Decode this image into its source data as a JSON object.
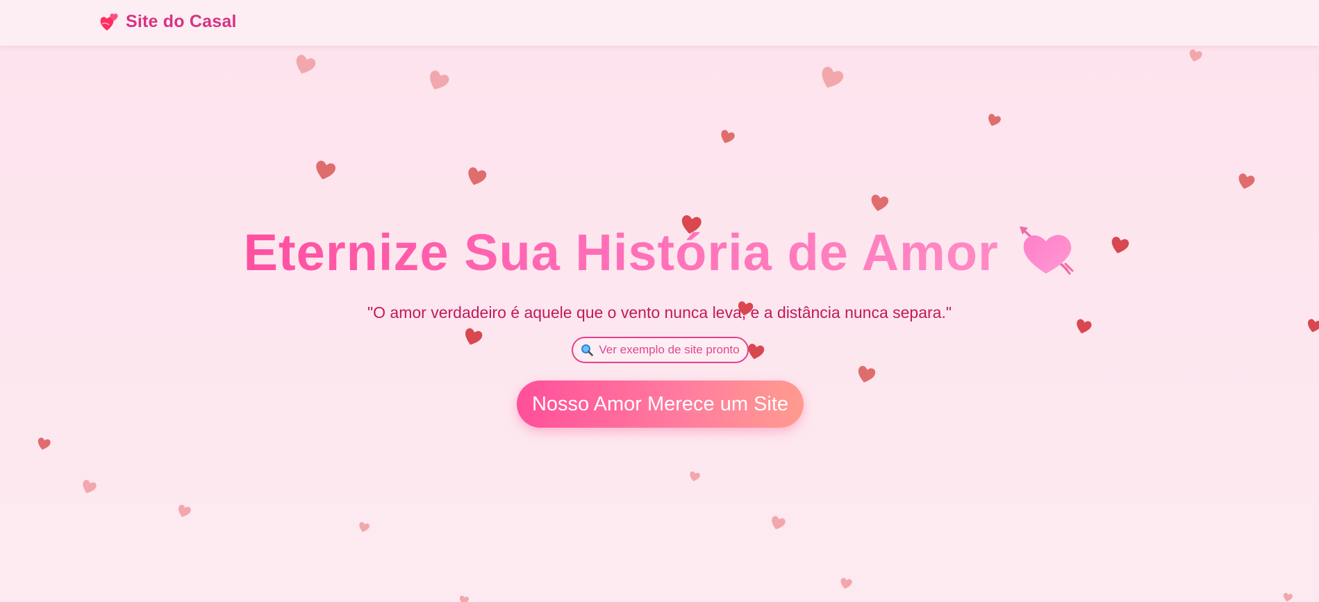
{
  "navbar": {
    "brand_icon": "two-hearts-icon",
    "brand_text": "Site do Casal"
  },
  "hero": {
    "title": "Eternize Sua História de Amor",
    "title_icon": "heart-with-arrow-icon",
    "quote": "\"O amor verdadeiro é aquele que o vento nunca leva, e a distância nunca separa.\"",
    "example_link": {
      "icon": "magnifying-glass-icon",
      "label": "Ver exemplo de site pronto"
    },
    "cta_label": "Nosso Amor Merece um Site"
  },
  "colors": {
    "brand": "#d63384",
    "title_gradient_start": "#ff4fa0",
    "title_gradient_end": "#ff8ac4",
    "quote": "#c2185b",
    "cta_gradient_start": "#ff4f9a",
    "cta_gradient_end": "#ff9b8e",
    "background": "#fde6ee",
    "heart_light": "#f2a7ad",
    "heart_dark": "#e06d6d",
    "heart_red": "#d9474f"
  },
  "decor": {
    "floating_icon": "heart-icon"
  }
}
